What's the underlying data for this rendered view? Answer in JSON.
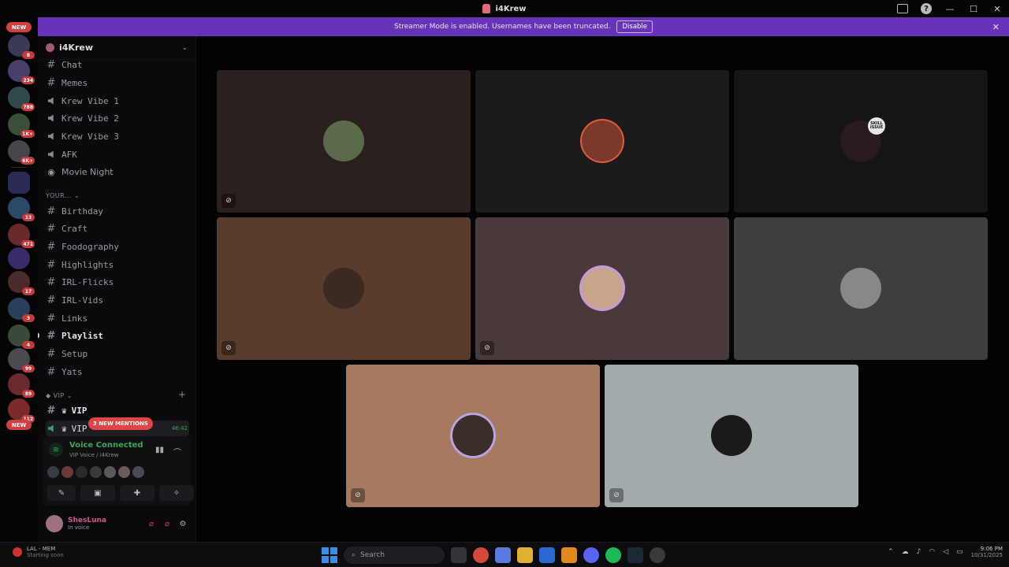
{
  "window": {
    "title": "i4Krew"
  },
  "banner": {
    "text": "Streamer Mode is enabled. Usernames have been truncated.",
    "disable_label": "Disable"
  },
  "rail": {
    "new_top": "NEW",
    "new_bottom": "NEW",
    "badges": [
      "8",
      "234",
      "788",
      "1K+",
      "6K+",
      "13",
      "471",
      "17",
      "3",
      "4",
      "99",
      "89",
      "112"
    ]
  },
  "guild": {
    "name": "i4Krew"
  },
  "channels": [
    {
      "name": "Chat",
      "type": "text",
      "state": "normal"
    },
    {
      "name": "Memes",
      "type": "text",
      "state": "normal"
    },
    {
      "name": "Krew Vibe 1",
      "type": "voice",
      "state": "normal"
    },
    {
      "name": "Krew Vibe 2",
      "type": "voice",
      "state": "normal"
    },
    {
      "name": "Krew Vibe 3",
      "type": "voice",
      "state": "normal"
    },
    {
      "name": "AFK",
      "type": "voice",
      "state": "normal"
    },
    {
      "name": "Movie Night",
      "type": "stage",
      "state": "normal"
    }
  ],
  "category_your": {
    "label": "YOUR..."
  },
  "your_channels": [
    {
      "name": "Birthday",
      "state": "normal"
    },
    {
      "name": "Craft",
      "state": "normal"
    },
    {
      "name": "Foodography",
      "state": "normal"
    },
    {
      "name": "Highlights",
      "state": "normal"
    },
    {
      "name": "IRL-Flicks",
      "state": "normal"
    },
    {
      "name": "IRL-Vids",
      "state": "normal"
    },
    {
      "name": "Links",
      "state": "normal"
    },
    {
      "name": "Playlist",
      "state": "unread"
    },
    {
      "name": "Setup",
      "state": "normal"
    },
    {
      "name": "Yats",
      "state": "normal"
    }
  ],
  "category_vip": {
    "label": "VIP"
  },
  "vip_channels": [
    {
      "name": "VIP",
      "type": "text"
    },
    {
      "name": "VIP",
      "type": "voice",
      "time": "46:42"
    }
  ],
  "mentions_pill": "3 NEW MENTIONS",
  "voice": {
    "status": "Voice Connected",
    "location": "VIP Voice / i4Krew"
  },
  "user": {
    "name": "ShesLuna",
    "status": "In voice"
  },
  "tiles": [
    {
      "bg": "#2a201d",
      "avatar": "#5a6a4a",
      "muted": true
    },
    {
      "bg": "#1c1b1c",
      "avatar": "#7a3a2a",
      "muted": false
    },
    {
      "bg": "#151515",
      "avatar": "#2a1a22",
      "muted": false,
      "badge": "SKILL ISSUE"
    },
    {
      "bg": "#5a3c2c",
      "avatar": "#3a2a22",
      "muted": true
    },
    {
      "bg": "#4a393a",
      "avatar": "#c8a58a",
      "muted": true
    },
    {
      "bg": "#3e3e40",
      "avatar": "#888",
      "muted": false
    },
    {
      "bg": "#a57a61",
      "avatar": "#3a2e2a",
      "muted": true
    },
    {
      "bg": "#a3aaac",
      "avatar": "#1a1a1a",
      "muted": true
    }
  ],
  "taskbar": {
    "widget_title": "LAL - MEM",
    "widget_sub": "Starting soon",
    "search_placeholder": "Search",
    "time": "9:06 PM",
    "date": "10/31/2025"
  }
}
